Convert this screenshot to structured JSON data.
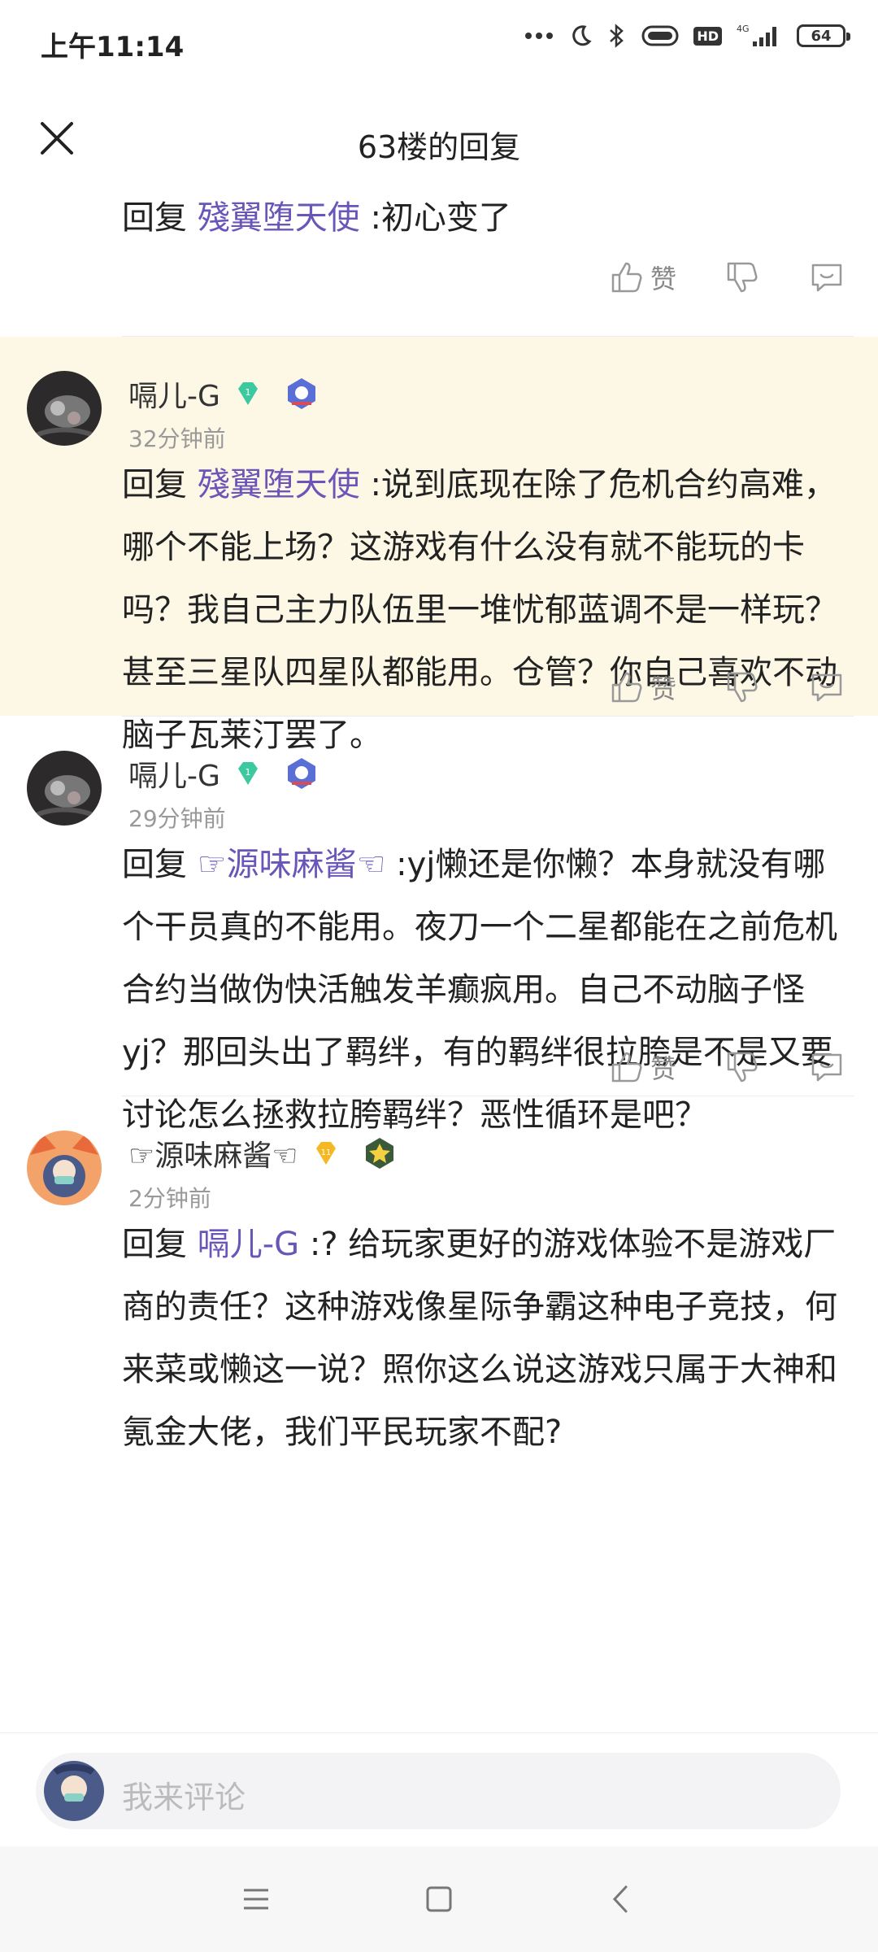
{
  "status_bar": {
    "time": "上午11:14",
    "battery": "64",
    "network": "4G",
    "hd": "HD"
  },
  "header": {
    "title": "63楼的回复"
  },
  "top_comment": {
    "prefix": "回复",
    "mention": "殘翼堕天使",
    "text": ":初心变了"
  },
  "actions": {
    "like_label": "赞"
  },
  "comments": [
    {
      "user": "嗝儿-G",
      "level": "1",
      "time": "32分钟前",
      "prefix": "回复",
      "mention": "殘翼堕天使",
      "text": ":说到底现在除了危机合约高难，哪个不能上场？这游戏有什么没有就不能玩的卡吗？我自己主力队伍里一堆忧郁蓝调不是一样玩？甚至三星队四星队都能用。仓管？你自己喜欢不动脑子瓦莱汀罢了。",
      "highlighted": true
    },
    {
      "user": "嗝儿-G",
      "level": "1",
      "time": "29分钟前",
      "prefix": "回复",
      "mention": "☞源味麻酱☜",
      "text": ":yj懒还是你懒？本身就没有哪个干员真的不能用。夜刀一个二星都能在之前危机合约当做伪快活触发羊癫疯用。自己不动脑子怪yj？那回头出了羁绊，有的羁绊很拉胯是不是又要讨论怎么拯救拉胯羁绊？恶性循环是吧？",
      "highlighted": false
    },
    {
      "user": "☞源味麻酱☜",
      "level": "11",
      "time": "2分钟前",
      "prefix": "回复",
      "mention": "嗝儿-G",
      "text": ":? 给玩家更好的游戏体验不是游戏厂商的责任？这种游戏像星际争霸这种电子竞技，何来菜或懒这一说？照你这么说这游戏只属于大神和氪金大佬，我们平民玩家不配?",
      "highlighted": false
    }
  ],
  "comment_bar": {
    "placeholder": "我来评论"
  },
  "colors": {
    "mention": "#6a55b8",
    "highlight_bg": "#fdf8e6",
    "gem_green": "#3cc9a0",
    "gem_gold": "#f5b822"
  }
}
